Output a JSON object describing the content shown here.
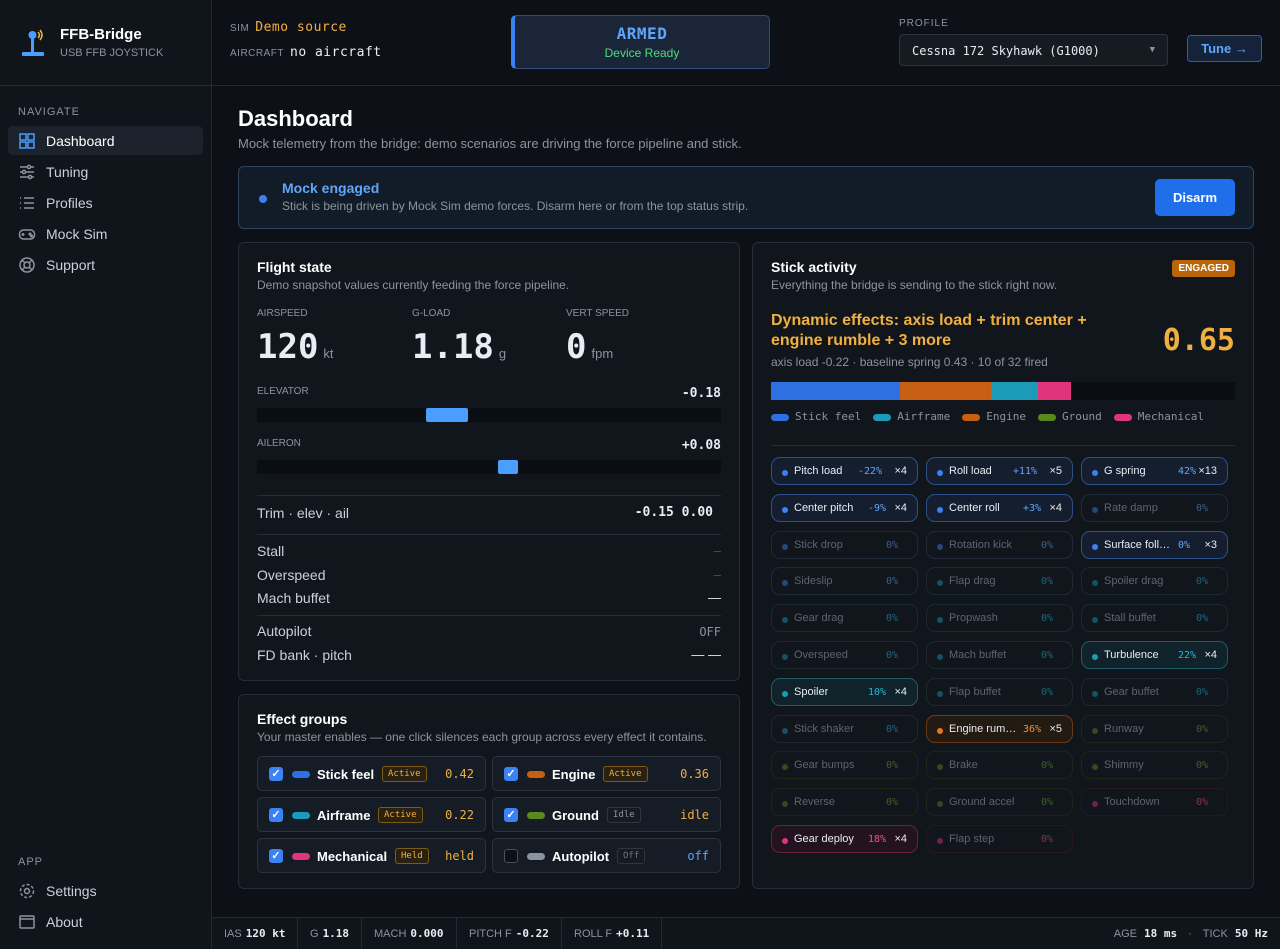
{
  "brand": {
    "name": "FFB-Bridge",
    "sub": "USB FFB JOYSTICK"
  },
  "nav": {
    "heading": "NAVIGATE",
    "items": [
      "Dashboard",
      "Tuning",
      "Profiles",
      "Mock Sim",
      "Support"
    ],
    "app_heading": "APP",
    "app_items": [
      "Settings",
      "About"
    ]
  },
  "top": {
    "sim_label": "SIM",
    "sim_value": "Demo source",
    "aircraft_label": "AIRCRAFT",
    "aircraft_value": "no aircraft",
    "status": "ARMED",
    "status_sub": "Device Ready",
    "profile_label": "PROFILE",
    "profile_value": "Cessna 172 Skyhawk (G1000)",
    "tune": "Tune →"
  },
  "page": {
    "title": "Dashboard",
    "subtitle": "Mock telemetry from the bridge: demo scenarios are driving the force pipeline and stick."
  },
  "banner": {
    "title": "Mock engaged",
    "desc": "Stick is being driven by Mock Sim demo forces. Disarm here or from the top status strip.",
    "button": "Disarm"
  },
  "flight": {
    "title": "Flight state",
    "subtitle": "Demo snapshot values currently feeding the force pipeline.",
    "stats": [
      {
        "label": "AIRSPEED",
        "value": "120",
        "unit": "kt"
      },
      {
        "label": "G-LOAD",
        "value": "1.18",
        "unit": "g"
      },
      {
        "label": "VERT SPEED",
        "value": "0",
        "unit": "fpm"
      }
    ],
    "elevator": {
      "label": "ELEVATOR",
      "value": "-0.18",
      "level": -0.18
    },
    "aileron": {
      "label": "AILERON",
      "value": "+0.08",
      "level": 0.08
    },
    "trim": {
      "label": "Trim · elev · ail",
      "value": "-0.15 0.00"
    },
    "stall": {
      "label": "Stall",
      "value": "–"
    },
    "overspeed": {
      "label": "Overspeed",
      "value": "–"
    },
    "mach": {
      "label": "Mach buffet",
      "value": "—"
    },
    "autopilot": {
      "label": "Autopilot",
      "value": "OFF"
    },
    "fd": {
      "label": "FD bank · pitch",
      "value": "— —"
    }
  },
  "groups": {
    "title": "Effect groups",
    "subtitle": "Your master enables — one click silences each group across every effect it contains.",
    "items": [
      {
        "name": "Stick feel",
        "state": "Active",
        "value": "0.42",
        "on": true,
        "color": "#2f6fe4"
      },
      {
        "name": "Engine",
        "state": "Active",
        "value": "0.36",
        "on": true,
        "color": "#c65f12"
      },
      {
        "name": "Airframe",
        "state": "Active",
        "value": "0.22",
        "on": true,
        "color": "#1b9bb8"
      },
      {
        "name": "Ground",
        "state": "Idle",
        "value": "idle",
        "on": true,
        "color": "#5a8a1e"
      },
      {
        "name": "Mechanical",
        "state": "Held",
        "value": "held",
        "on": true,
        "color": "#e0357c"
      },
      {
        "name": "Autopilot",
        "state": "Off",
        "value": "off",
        "on": false,
        "color": "#8b949e"
      }
    ]
  },
  "stick": {
    "title": "Stick activity",
    "subtitle": "Everything the bridge is sending to the stick right now.",
    "badge": "ENGAGED",
    "dynamic": "Dynamic effects: axis load + trim center + engine rumble + 3 more",
    "value": "0.65",
    "detail": "axis load -0.22 · baseline spring 0.43 · 10 of 32 fired",
    "bar": [
      {
        "name": "Stick feel",
        "share": 0.277,
        "color": "#2f6fe4"
      },
      {
        "name": "Engine",
        "share": 0.198,
        "color": "#c65f12"
      },
      {
        "name": "Airframe",
        "share": 0.1,
        "color": "#1b9bb8"
      },
      {
        "name": "Mechanical",
        "share": 0.072,
        "color": "#e0357c"
      }
    ],
    "legend": [
      {
        "name": "Stick feel",
        "color": "#2f6fe4"
      },
      {
        "name": "Airframe",
        "color": "#1b9bb8"
      },
      {
        "name": "Engine",
        "color": "#c65f12"
      },
      {
        "name": "Ground",
        "color": "#5a8a1e"
      },
      {
        "name": "Mechanical",
        "color": "#e0357c"
      }
    ],
    "chips": [
      {
        "n": "Pitch load",
        "p": "-22%",
        "x": "×4",
        "g": "stick",
        "a": true
      },
      {
        "n": "Roll load",
        "p": "+11%",
        "x": "×5",
        "g": "stick",
        "a": true
      },
      {
        "n": "G spring",
        "p": "42%",
        "x": "×13",
        "g": "stick",
        "a": true
      },
      {
        "n": "Center pitch",
        "p": "-9%",
        "x": "×4",
        "g": "stick",
        "a": true
      },
      {
        "n": "Center roll",
        "p": "+3%",
        "x": "×4",
        "g": "stick",
        "a": true
      },
      {
        "n": "Rate damp",
        "p": "0%",
        "x": "",
        "g": "stick",
        "a": false
      },
      {
        "n": "Stick drop",
        "p": "0%",
        "x": "",
        "g": "stick",
        "a": false
      },
      {
        "n": "Rotation kick",
        "p": "0%",
        "x": "",
        "g": "stick",
        "a": false
      },
      {
        "n": "Surface following",
        "p": "0%",
        "x": "×3",
        "g": "stick",
        "a": true
      },
      {
        "n": "Sideslip",
        "p": "0%",
        "x": "",
        "g": "stick",
        "a": false
      },
      {
        "n": "Flap drag",
        "p": "0%",
        "x": "",
        "g": "air",
        "a": false
      },
      {
        "n": "Spoiler drag",
        "p": "0%",
        "x": "",
        "g": "air",
        "a": false
      },
      {
        "n": "Gear drag",
        "p": "0%",
        "x": "",
        "g": "air",
        "a": false
      },
      {
        "n": "Propwash",
        "p": "0%",
        "x": "",
        "g": "air",
        "a": false
      },
      {
        "n": "Stall buffet",
        "p": "0%",
        "x": "",
        "g": "air",
        "a": false
      },
      {
        "n": "Overspeed",
        "p": "0%",
        "x": "",
        "g": "air",
        "a": false
      },
      {
        "n": "Mach buffet",
        "p": "0%",
        "x": "",
        "g": "air",
        "a": false
      },
      {
        "n": "Turbulence",
        "p": "22%",
        "x": "×4",
        "g": "air",
        "a": true
      },
      {
        "n": "Spoiler",
        "p": "10%",
        "x": "×4",
        "g": "air",
        "a": true
      },
      {
        "n": "Flap buffet",
        "p": "0%",
        "x": "",
        "g": "air",
        "a": false
      },
      {
        "n": "Gear buffet",
        "p": "0%",
        "x": "",
        "g": "air",
        "a": false
      },
      {
        "n": "Stick shaker",
        "p": "0%",
        "x": "",
        "g": "air",
        "a": false
      },
      {
        "n": "Engine rumble",
        "p": "36%",
        "x": "×5",
        "g": "eng",
        "a": true
      },
      {
        "n": "Runway",
        "p": "0%",
        "x": "",
        "g": "gnd",
        "a": false
      },
      {
        "n": "Gear bumps",
        "p": "0%",
        "x": "",
        "g": "gnd",
        "a": false
      },
      {
        "n": "Brake",
        "p": "0%",
        "x": "",
        "g": "gnd",
        "a": false
      },
      {
        "n": "Shimmy",
        "p": "0%",
        "x": "",
        "g": "gnd",
        "a": false
      },
      {
        "n": "Reverse",
        "p": "0%",
        "x": "",
        "g": "gnd",
        "a": false
      },
      {
        "n": "Ground accel",
        "p": "0%",
        "x": "",
        "g": "gnd",
        "a": false
      },
      {
        "n": "Touchdown",
        "p": "0%",
        "x": "",
        "g": "mech",
        "a": false
      },
      {
        "n": "Gear deploy",
        "p": "18%",
        "x": "×4",
        "g": "mech",
        "a": true
      },
      {
        "n": "Flap step",
        "p": "0%",
        "x": "",
        "g": "mech",
        "a": false
      }
    ]
  },
  "status": {
    "segs": [
      {
        "l": "IAS",
        "v": "120 kt"
      },
      {
        "l": "G",
        "v": "1.18"
      },
      {
        "l": "MACH",
        "v": "0.000"
      },
      {
        "l": "PITCH F",
        "v": "-0.22"
      },
      {
        "l": "ROLL F",
        "v": "+0.11"
      }
    ],
    "age_label": "AGE",
    "age": "18 ms",
    "tick_label": "TICK",
    "tick": "50 Hz"
  }
}
